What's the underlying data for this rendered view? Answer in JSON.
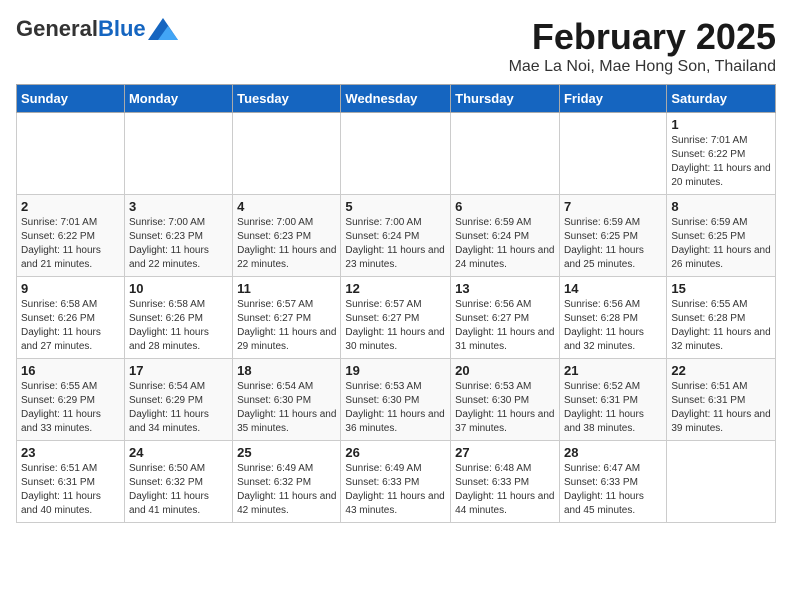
{
  "header": {
    "logo_general": "General",
    "logo_blue": "Blue",
    "month_title": "February 2025",
    "location": "Mae La Noi, Mae Hong Son, Thailand"
  },
  "days_of_week": [
    "Sunday",
    "Monday",
    "Tuesday",
    "Wednesday",
    "Thursday",
    "Friday",
    "Saturday"
  ],
  "weeks": [
    [
      {
        "day": "",
        "info": ""
      },
      {
        "day": "",
        "info": ""
      },
      {
        "day": "",
        "info": ""
      },
      {
        "day": "",
        "info": ""
      },
      {
        "day": "",
        "info": ""
      },
      {
        "day": "",
        "info": ""
      },
      {
        "day": "1",
        "info": "Sunrise: 7:01 AM\nSunset: 6:22 PM\nDaylight: 11 hours and 20 minutes."
      }
    ],
    [
      {
        "day": "2",
        "info": "Sunrise: 7:01 AM\nSunset: 6:22 PM\nDaylight: 11 hours and 21 minutes."
      },
      {
        "day": "3",
        "info": "Sunrise: 7:00 AM\nSunset: 6:23 PM\nDaylight: 11 hours and 22 minutes."
      },
      {
        "day": "4",
        "info": "Sunrise: 7:00 AM\nSunset: 6:23 PM\nDaylight: 11 hours and 22 minutes."
      },
      {
        "day": "5",
        "info": "Sunrise: 7:00 AM\nSunset: 6:24 PM\nDaylight: 11 hours and 23 minutes."
      },
      {
        "day": "6",
        "info": "Sunrise: 6:59 AM\nSunset: 6:24 PM\nDaylight: 11 hours and 24 minutes."
      },
      {
        "day": "7",
        "info": "Sunrise: 6:59 AM\nSunset: 6:25 PM\nDaylight: 11 hours and 25 minutes."
      },
      {
        "day": "8",
        "info": "Sunrise: 6:59 AM\nSunset: 6:25 PM\nDaylight: 11 hours and 26 minutes."
      }
    ],
    [
      {
        "day": "9",
        "info": "Sunrise: 6:58 AM\nSunset: 6:26 PM\nDaylight: 11 hours and 27 minutes."
      },
      {
        "day": "10",
        "info": "Sunrise: 6:58 AM\nSunset: 6:26 PM\nDaylight: 11 hours and 28 minutes."
      },
      {
        "day": "11",
        "info": "Sunrise: 6:57 AM\nSunset: 6:27 PM\nDaylight: 11 hours and 29 minutes."
      },
      {
        "day": "12",
        "info": "Sunrise: 6:57 AM\nSunset: 6:27 PM\nDaylight: 11 hours and 30 minutes."
      },
      {
        "day": "13",
        "info": "Sunrise: 6:56 AM\nSunset: 6:27 PM\nDaylight: 11 hours and 31 minutes."
      },
      {
        "day": "14",
        "info": "Sunrise: 6:56 AM\nSunset: 6:28 PM\nDaylight: 11 hours and 32 minutes."
      },
      {
        "day": "15",
        "info": "Sunrise: 6:55 AM\nSunset: 6:28 PM\nDaylight: 11 hours and 32 minutes."
      }
    ],
    [
      {
        "day": "16",
        "info": "Sunrise: 6:55 AM\nSunset: 6:29 PM\nDaylight: 11 hours and 33 minutes."
      },
      {
        "day": "17",
        "info": "Sunrise: 6:54 AM\nSunset: 6:29 PM\nDaylight: 11 hours and 34 minutes."
      },
      {
        "day": "18",
        "info": "Sunrise: 6:54 AM\nSunset: 6:30 PM\nDaylight: 11 hours and 35 minutes."
      },
      {
        "day": "19",
        "info": "Sunrise: 6:53 AM\nSunset: 6:30 PM\nDaylight: 11 hours and 36 minutes."
      },
      {
        "day": "20",
        "info": "Sunrise: 6:53 AM\nSunset: 6:30 PM\nDaylight: 11 hours and 37 minutes."
      },
      {
        "day": "21",
        "info": "Sunrise: 6:52 AM\nSunset: 6:31 PM\nDaylight: 11 hours and 38 minutes."
      },
      {
        "day": "22",
        "info": "Sunrise: 6:51 AM\nSunset: 6:31 PM\nDaylight: 11 hours and 39 minutes."
      }
    ],
    [
      {
        "day": "23",
        "info": "Sunrise: 6:51 AM\nSunset: 6:31 PM\nDaylight: 11 hours and 40 minutes."
      },
      {
        "day": "24",
        "info": "Sunrise: 6:50 AM\nSunset: 6:32 PM\nDaylight: 11 hours and 41 minutes."
      },
      {
        "day": "25",
        "info": "Sunrise: 6:49 AM\nSunset: 6:32 PM\nDaylight: 11 hours and 42 minutes."
      },
      {
        "day": "26",
        "info": "Sunrise: 6:49 AM\nSunset: 6:33 PM\nDaylight: 11 hours and 43 minutes."
      },
      {
        "day": "27",
        "info": "Sunrise: 6:48 AM\nSunset: 6:33 PM\nDaylight: 11 hours and 44 minutes."
      },
      {
        "day": "28",
        "info": "Sunrise: 6:47 AM\nSunset: 6:33 PM\nDaylight: 11 hours and 45 minutes."
      },
      {
        "day": "",
        "info": ""
      }
    ]
  ]
}
